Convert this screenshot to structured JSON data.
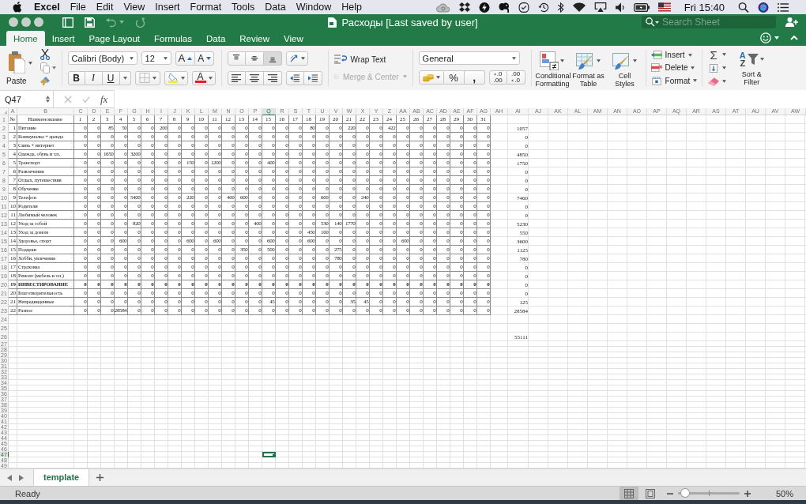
{
  "menu_bar": {
    "app": "Excel",
    "items": [
      "File",
      "Edit",
      "View",
      "Insert",
      "Format",
      "Tools",
      "Data",
      "Window",
      "Help"
    ],
    "clock": "Fri 15:40"
  },
  "title_bar": {
    "title": "Расходы [Last saved by user]",
    "search": {
      "placeholder": "Search Sheet"
    }
  },
  "ribbon_tabs": [
    {
      "label": "Home",
      "selected": true
    },
    {
      "label": "Insert",
      "selected": false
    },
    {
      "label": "Page Layout",
      "selected": false
    },
    {
      "label": "Formulas",
      "selected": false
    },
    {
      "label": "Data",
      "selected": false
    },
    {
      "label": "Review",
      "selected": false
    },
    {
      "label": "View",
      "selected": false
    }
  ],
  "ribbon": {
    "clipboard": {
      "paste": "Paste"
    },
    "font": {
      "family": "Calibri (Body)",
      "size": "12",
      "grow": "A",
      "shrink": "A",
      "bold": "B",
      "italic": "I",
      "underline": "U",
      "text_color_letter": "A"
    },
    "alignment": {
      "vertical": [
        {
          "selected": false
        },
        {
          "selected": false
        },
        {
          "selected": true
        }
      ]
    },
    "wrap_text": {
      "label": "Wrap Text",
      "disabled": false
    },
    "merge_center": {
      "label": "Merge & Center",
      "disabled": true
    },
    "number": {
      "format": "General",
      "percent": "%",
      "comma": ",",
      "decimals": [
        {
          "top": ".0",
          "bottom": ".00"
        },
        {
          "top": ".00",
          "bottom": ".0"
        }
      ]
    },
    "styles": [
      {
        "kind": "conditional",
        "label": "Conditional Formatting"
      },
      {
        "kind": "table",
        "label": "Format as Table"
      },
      {
        "kind": "cell",
        "label": "Cell Styles"
      }
    ],
    "cells": [
      {
        "kind": "insert",
        "label": "Insert"
      },
      {
        "kind": "delete",
        "label": "Delete"
      },
      {
        "kind": "format",
        "label": "Format"
      }
    ],
    "editing": {
      "sum": "Σ",
      "sort_letters": [
        "A",
        "Z"
      ],
      "sort_filter": "Sort & Filter"
    }
  },
  "formula_bar": {
    "name_box": "Q47",
    "fx": "fx"
  },
  "sheet": {
    "columns": [
      {
        "label": "A",
        "selected": false
      },
      {
        "label": "B",
        "selected": false
      },
      {
        "label": "C",
        "selected": false
      },
      {
        "label": "D",
        "selected": false
      },
      {
        "label": "E",
        "selected": false
      },
      {
        "label": "F",
        "selected": false
      },
      {
        "label": "G",
        "selected": false
      },
      {
        "label": "H",
        "selected": false
      },
      {
        "label": "I",
        "selected": false
      },
      {
        "label": "J",
        "selected": false
      },
      {
        "label": "K",
        "selected": false
      },
      {
        "label": "L",
        "selected": false
      },
      {
        "label": "M",
        "selected": false
      },
      {
        "label": "N",
        "selected": false
      },
      {
        "label": "O",
        "selected": false
      },
      {
        "label": "P",
        "selected": false
      },
      {
        "label": "Q",
        "selected": true
      },
      {
        "label": "R",
        "selected": false
      },
      {
        "label": "S",
        "selected": false
      },
      {
        "label": "T",
        "selected": false
      },
      {
        "label": "U",
        "selected": false
      },
      {
        "label": "V",
        "selected": false
      },
      {
        "label": "W",
        "selected": false
      },
      {
        "label": "X",
        "selected": false
      },
      {
        "label": "Y",
        "selected": false
      },
      {
        "label": "Z",
        "selected": false
      },
      {
        "label": "AA",
        "selected": false
      },
      {
        "label": "AB",
        "selected": false
      },
      {
        "label": "AC",
        "selected": false
      },
      {
        "label": "AD",
        "selected": false
      },
      {
        "label": "AE",
        "selected": false
      },
      {
        "label": "AF",
        "selected": false
      },
      {
        "label": "AG",
        "selected": false
      },
      {
        "label": "AH",
        "selected": false
      },
      {
        "label": "AI",
        "selected": false
      },
      {
        "label": "AJ",
        "selected": false
      },
      {
        "label": "AK",
        "selected": false
      },
      {
        "label": "AL",
        "selected": false
      },
      {
        "label": "AM",
        "selected": false
      },
      {
        "label": "AN",
        "selected": false
      },
      {
        "label": "AO",
        "selected": false
      },
      {
        "label": "AP",
        "selected": false
      },
      {
        "label": "AQ",
        "selected": false
      },
      {
        "label": "AR",
        "selected": false
      },
      {
        "label": "AS",
        "selected": false
      },
      {
        "label": "AT",
        "selected": false
      },
      {
        "label": "AU",
        "selected": false
      },
      {
        "label": "AV",
        "selected": false
      },
      {
        "label": "AW",
        "selected": false
      }
    ],
    "row_headers": [
      {
        "label": "1",
        "selected": false
      },
      {
        "label": "2",
        "selected": false
      },
      {
        "label": "3",
        "selected": false
      },
      {
        "label": "4",
        "selected": false
      },
      {
        "label": "5",
        "selected": false
      },
      {
        "label": "6",
        "selected": false
      },
      {
        "label": "7",
        "selected": false
      },
      {
        "label": "8",
        "selected": false
      },
      {
        "label": "9",
        "selected": false
      },
      {
        "label": "10",
        "selected": false
      },
      {
        "label": "11",
        "selected": false
      },
      {
        "label": "12",
        "selected": false
      },
      {
        "label": "13",
        "selected": false
      },
      {
        "label": "14",
        "selected": false
      },
      {
        "label": "15",
        "selected": false
      },
      {
        "label": "16",
        "selected": false
      },
      {
        "label": "17",
        "selected": false
      },
      {
        "label": "18",
        "selected": false
      },
      {
        "label": "19",
        "selected": false
      },
      {
        "label": "20",
        "selected": false
      },
      {
        "label": "21",
        "selected": false
      },
      {
        "label": "22",
        "selected": false
      },
      {
        "label": "23",
        "selected": false
      },
      {
        "label": "24",
        "selected": false
      },
      {
        "label": "25",
        "selected": false
      },
      {
        "label": "26",
        "selected": false
      },
      {
        "label": "27",
        "selected": false
      },
      {
        "label": "28",
        "selected": false
      },
      {
        "label": "29",
        "selected": false
      },
      {
        "label": "30",
        "selected": false
      },
      {
        "label": "31",
        "selected": false
      },
      {
        "label": "32",
        "selected": false
      },
      {
        "label": "33",
        "selected": false
      },
      {
        "label": "34",
        "selected": false
      },
      {
        "label": "35",
        "selected": false
      },
      {
        "label": "36",
        "selected": false
      },
      {
        "label": "37",
        "selected": false
      },
      {
        "label": "38",
        "selected": false
      },
      {
        "label": "39",
        "selected": false
      },
      {
        "label": "40",
        "selected": false
      },
      {
        "label": "41",
        "selected": false
      },
      {
        "label": "42",
        "selected": false
      },
      {
        "label": "43",
        "selected": false
      },
      {
        "label": "44",
        "selected": false
      },
      {
        "label": "45",
        "selected": false
      },
      {
        "label": "46",
        "selected": false
      },
      {
        "label": "47",
        "selected": true
      },
      {
        "label": "48",
        "selected": false
      },
      {
        "label": "49",
        "selected": false
      }
    ],
    "header": {
      "number": "№",
      "name": "Наименование",
      "days": [
        "1",
        "2",
        "3",
        "4",
        "5",
        "6",
        "7",
        "8",
        "9",
        "10",
        "11",
        "12",
        "13",
        "14",
        "15",
        "16",
        "17",
        "18",
        "19",
        "20",
        "21",
        "22",
        "23",
        "24",
        "25",
        "26",
        "27",
        "28",
        "29",
        "30",
        "31"
      ]
    },
    "rows": [
      {
        "num": "1",
        "name": "Питание",
        "bold": false,
        "total": "1057",
        "days": [
          "0",
          "0",
          "85",
          "50",
          "0",
          "0",
          "200",
          "0",
          "0",
          "0",
          "0",
          "0",
          "0",
          "0",
          "0",
          "0",
          "0",
          "80",
          "0",
          "0",
          "220",
          "0",
          "0",
          "422",
          "0",
          "0",
          "0",
          "0",
          "0",
          "0",
          "0"
        ]
      },
      {
        "num": "2",
        "name": "Коммуналка + аренда",
        "bold": false,
        "total": "0",
        "days": [
          "0",
          "0",
          "0",
          "0",
          "0",
          "0",
          "0",
          "0",
          "0",
          "0",
          "0",
          "0",
          "0",
          "0",
          "0",
          "0",
          "0",
          "0",
          "0",
          "0",
          "0",
          "0",
          "0",
          "0",
          "0",
          "0",
          "0",
          "0",
          "0",
          "0",
          "0"
        ]
      },
      {
        "num": "3",
        "name": "Связь + интернет",
        "bold": false,
        "total": "0",
        "days": [
          "0",
          "0",
          "0",
          "0",
          "0",
          "0",
          "0",
          "0",
          "0",
          "0",
          "0",
          "0",
          "0",
          "0",
          "0",
          "0",
          "0",
          "0",
          "0",
          "0",
          "0",
          "0",
          "0",
          "0",
          "0",
          "0",
          "0",
          "0",
          "0",
          "0",
          "0"
        ]
      },
      {
        "num": "4",
        "name": "Одежда, обувь и т.п.",
        "bold": false,
        "total": "4850",
        "days": [
          "0",
          "0",
          "1650",
          "0",
          "3200",
          "0",
          "0",
          "0",
          "0",
          "0",
          "0",
          "0",
          "0",
          "0",
          "0",
          "0",
          "0",
          "0",
          "0",
          "0",
          "0",
          "0",
          "0",
          "0",
          "0",
          "0",
          "0",
          "0",
          "0",
          "0",
          "0"
        ]
      },
      {
        "num": "5",
        "name": "Транспорт",
        "bold": false,
        "total": "1750",
        "days": [
          "0",
          "0",
          "0",
          "0",
          "0",
          "0",
          "0",
          "0",
          "150",
          "0",
          "1200",
          "0",
          "0",
          "0",
          "400",
          "0",
          "0",
          "0",
          "0",
          "0",
          "0",
          "0",
          "0",
          "0",
          "0",
          "0",
          "0",
          "0",
          "0",
          "0",
          "0"
        ]
      },
      {
        "num": "6",
        "name": "Развлечения",
        "bold": false,
        "total": "0",
        "days": [
          "0",
          "0",
          "0",
          "0",
          "0",
          "0",
          "0",
          "0",
          "0",
          "0",
          "0",
          "0",
          "0",
          "0",
          "0",
          "0",
          "0",
          "0",
          "0",
          "0",
          "0",
          "0",
          "0",
          "0",
          "0",
          "0",
          "0",
          "0",
          "0",
          "0",
          "0"
        ]
      },
      {
        "num": "7",
        "name": "Отдых, путешествия",
        "bold": false,
        "total": "0",
        "days": [
          "0",
          "0",
          "0",
          "0",
          "0",
          "0",
          "0",
          "0",
          "0",
          "0",
          "0",
          "0",
          "0",
          "0",
          "0",
          "0",
          "0",
          "0",
          "0",
          "0",
          "0",
          "0",
          "0",
          "0",
          "0",
          "0",
          "0",
          "0",
          "0",
          "0",
          "0"
        ]
      },
      {
        "num": "8",
        "name": "Обучение",
        "bold": false,
        "total": "0",
        "days": [
          "0",
          "0",
          "0",
          "0",
          "0",
          "0",
          "0",
          "0",
          "0",
          "0",
          "0",
          "0",
          "0",
          "0",
          "0",
          "0",
          "0",
          "0",
          "0",
          "0",
          "0",
          "0",
          "0",
          "0",
          "0",
          "0",
          "0",
          "0",
          "0",
          "0",
          "0"
        ]
      },
      {
        "num": "9",
        "name": "Телефон",
        "bold": false,
        "total": "7460",
        "days": [
          "0",
          "0",
          "0",
          "0",
          "5400",
          "0",
          "0",
          "0",
          "220",
          "0",
          "0",
          "400",
          "600",
          "0",
          "0",
          "0",
          "0",
          "0",
          "600",
          "0",
          "0",
          "240",
          "0",
          "0",
          "0",
          "0",
          "0",
          "0",
          "0",
          "0",
          "0"
        ]
      },
      {
        "num": "10",
        "name": "Родители",
        "bold": false,
        "total": "0",
        "days": [
          "0",
          "0",
          "0",
          "0",
          "0",
          "0",
          "0",
          "0",
          "0",
          "0",
          "0",
          "0",
          "0",
          "0",
          "0",
          "0",
          "0",
          "0",
          "0",
          "0",
          "0",
          "0",
          "0",
          "0",
          "0",
          "0",
          "0",
          "0",
          "0",
          "0",
          "0"
        ]
      },
      {
        "num": "11",
        "name": "Любимый человек",
        "bold": false,
        "total": "0",
        "days": [
          "0",
          "0",
          "0",
          "0",
          "0",
          "0",
          "0",
          "0",
          "0",
          "0",
          "0",
          "0",
          "0",
          "0",
          "0",
          "0",
          "0",
          "0",
          "0",
          "0",
          "0",
          "0",
          "0",
          "0",
          "0",
          "0",
          "0",
          "0",
          "0",
          "0",
          "0"
        ]
      },
      {
        "num": "12",
        "name": "Уход за собой",
        "bold": false,
        "total": "5230",
        "days": [
          "0",
          "0",
          "0",
          "0",
          "820",
          "0",
          "0",
          "0",
          "0",
          "0",
          "0",
          "0",
          "0",
          "400",
          "0",
          "0",
          "0",
          "0",
          "530",
          "140",
          "1770",
          "0",
          "0",
          "0",
          "0",
          "0",
          "0",
          "0",
          "0",
          "0",
          "0"
        ]
      },
      {
        "num": "13",
        "name": "Уход за домом",
        "bold": false,
        "total": "550",
        "days": [
          "0",
          "0",
          "0",
          "0",
          "0",
          "0",
          "0",
          "0",
          "0",
          "0",
          "0",
          "0",
          "0",
          "0",
          "0",
          "0",
          "0",
          "450",
          "100",
          "0",
          "0",
          "0",
          "0",
          "0",
          "0",
          "0",
          "0",
          "0",
          "0",
          "0",
          "0"
        ]
      },
      {
        "num": "14",
        "name": "Здоровье, спорт",
        "bold": false,
        "total": "3600",
        "days": [
          "0",
          "0",
          "0",
          "600",
          "0",
          "0",
          "0",
          "0",
          "600",
          "0",
          "600",
          "0",
          "0",
          "0",
          "600",
          "0",
          "0",
          "600",
          "0",
          "0",
          "0",
          "0",
          "0",
          "0",
          "600",
          "0",
          "0",
          "0",
          "0",
          "0",
          "0"
        ]
      },
      {
        "num": "15",
        "name": "Подарки",
        "bold": false,
        "total": "1125",
        "days": [
          "0",
          "0",
          "0",
          "0",
          "0",
          "0",
          "0",
          "0",
          "0",
          "0",
          "0",
          "0",
          "350",
          "0",
          "500",
          "0",
          "0",
          "0",
          "0",
          "275",
          "0",
          "0",
          "0",
          "0",
          "0",
          "0",
          "0",
          "0",
          "0",
          "0",
          "0"
        ]
      },
      {
        "num": "16",
        "name": "Хобби, увлечения",
        "bold": false,
        "total": "780",
        "days": [
          "0",
          "0",
          "0",
          "0",
          "0",
          "0",
          "0",
          "0",
          "0",
          "0",
          "0",
          "0",
          "0",
          "0",
          "0",
          "0",
          "0",
          "0",
          "0",
          "780",
          "0",
          "0",
          "0",
          "0",
          "0",
          "0",
          "0",
          "0",
          "0",
          "0",
          "0"
        ]
      },
      {
        "num": "17",
        "name": "Страховка",
        "bold": false,
        "total": "0",
        "days": [
          "0",
          "0",
          "0",
          "0",
          "0",
          "0",
          "0",
          "0",
          "0",
          "0",
          "0",
          "0",
          "0",
          "0",
          "0",
          "0",
          "0",
          "0",
          "0",
          "0",
          "0",
          "0",
          "0",
          "0",
          "0",
          "0",
          "0",
          "0",
          "0",
          "0",
          "0"
        ]
      },
      {
        "num": "18",
        "name": "Ремонт (мебель и т.п.)",
        "bold": false,
        "total": "0",
        "days": [
          "0",
          "0",
          "0",
          "0",
          "0",
          "0",
          "0",
          "0",
          "0",
          "0",
          "0",
          "0",
          "0",
          "0",
          "0",
          "0",
          "0",
          "0",
          "0",
          "0",
          "0",
          "0",
          "0",
          "0",
          "0",
          "0",
          "0",
          "0",
          "0",
          "0",
          "0"
        ]
      },
      {
        "num": "19",
        "name": "ИНВЕСТИРОВАНИЕ",
        "bold": true,
        "total": "0",
        "days": [
          "0",
          "0",
          "0",
          "0",
          "0",
          "0",
          "0",
          "0",
          "0",
          "0",
          "0",
          "0",
          "0",
          "0",
          "0",
          "0",
          "0",
          "0",
          "0",
          "0",
          "0",
          "0",
          "0",
          "0",
          "0",
          "0",
          "0",
          "0",
          "0",
          "0",
          "0"
        ]
      },
      {
        "num": "20",
        "name": "Благотворительность",
        "bold": false,
        "total": "0",
        "days": [
          "0",
          "0",
          "0",
          "0",
          "0",
          "0",
          "0",
          "0",
          "0",
          "0",
          "0",
          "0",
          "0",
          "0",
          "0",
          "0",
          "0",
          "0",
          "0",
          "0",
          "0",
          "0",
          "0",
          "0",
          "0",
          "0",
          "0",
          "0",
          "0",
          "0",
          "0"
        ]
      },
      {
        "num": "21",
        "name": "Непредвиденные",
        "bold": false,
        "total": "125",
        "days": [
          "0",
          "0",
          "0",
          "0",
          "0",
          "0",
          "0",
          "0",
          "0",
          "0",
          "0",
          "0",
          "0",
          "0",
          "45",
          "0",
          "0",
          "0",
          "0",
          "0",
          "35",
          "45",
          "0",
          "0",
          "0",
          "0",
          "0",
          "0",
          "0",
          "0",
          "0"
        ]
      },
      {
        "num": "22",
        "name": "Разное",
        "bold": false,
        "total": "28584",
        "days": [
          "0",
          "0",
          "0",
          "28584",
          "0",
          "0",
          "0",
          "0",
          "0",
          "0",
          "0",
          "0",
          "0",
          "0",
          "0",
          "0",
          "0",
          "0",
          "0",
          "0",
          "0",
          "0",
          "0",
          "0",
          "0",
          "0",
          "0",
          "0",
          "0",
          "0",
          "0"
        ]
      }
    ],
    "grand_total": "55111"
  },
  "sheet_tabs": [
    {
      "label": "template",
      "selected": true
    }
  ],
  "status_bar": {
    "text": "Ready",
    "views": [
      {
        "kind": "normal",
        "selected": true
      },
      {
        "kind": "page_layout",
        "selected": false
      }
    ],
    "zoom": {
      "level": 0.12,
      "label": "50%"
    }
  }
}
